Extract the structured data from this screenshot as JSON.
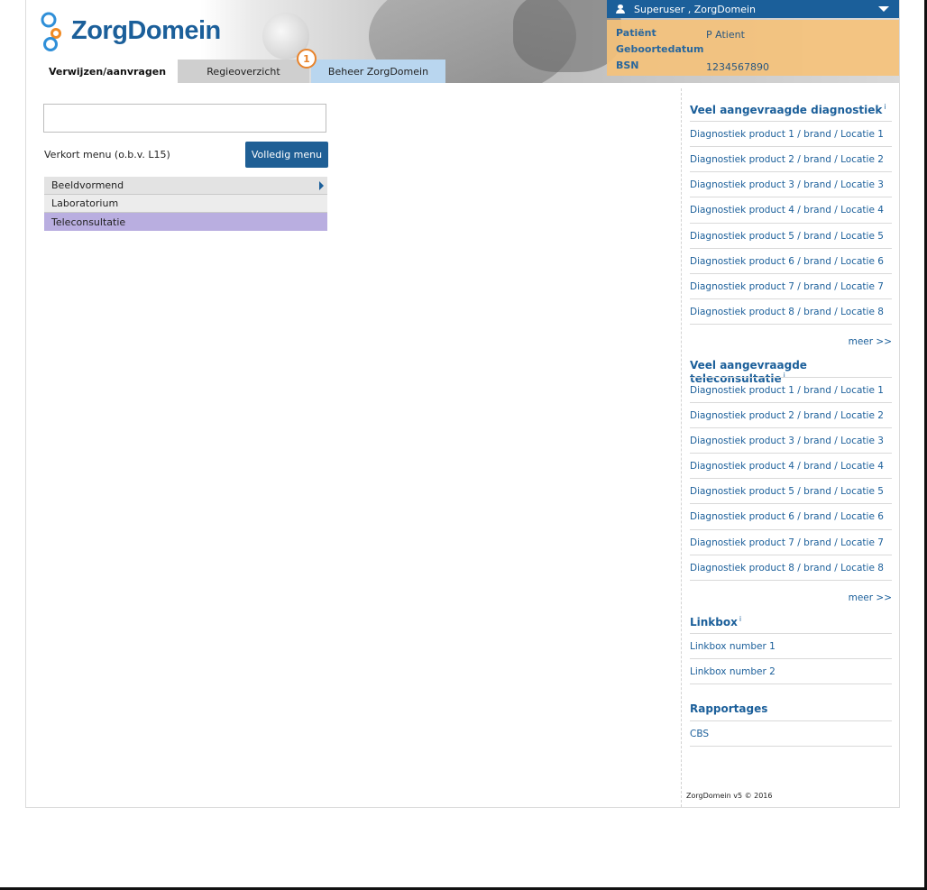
{
  "app": {
    "logo_text": "ZorgDomein"
  },
  "tabs": [
    {
      "label": "Verwijzen/aanvragen"
    },
    {
      "label": "Regieoverzicht"
    },
    {
      "label": "Beheer ZorgDomein"
    }
  ],
  "badge": "1",
  "user": {
    "label": "Superuser , ZorgDomein"
  },
  "patient": {
    "name_label": "Patiënt",
    "name": "P Atient",
    "dob_label": "Geboortedatum",
    "bsn_label": "BSN",
    "bsn": "1234567890"
  },
  "search": {
    "value": ""
  },
  "quick_menu": {
    "label": "Verkort menu (o.b.v. L15)",
    "full_button": "Volledig menu",
    "items": [
      {
        "label": "Beeldvormend"
      },
      {
        "label": "Laboratorium"
      },
      {
        "label": "Teleconsultatie"
      }
    ]
  },
  "diagnostiek": {
    "title": "Veel aangevraagde diagnostiek",
    "info": "i",
    "items": [
      "Diagnostiek product 1 / brand / Locatie 1",
      "Diagnostiek product 2 / brand / Locatie 2",
      "Diagnostiek product 3 / brand / Locatie 3",
      "Diagnostiek product 4 / brand / Locatie 4",
      "Diagnostiek product 5 / brand / Locatie 5",
      "Diagnostiek product 6 / brand / Locatie 6",
      "Diagnostiek product 7 / brand / Locatie 7",
      "Diagnostiek product 8 / brand / Locatie 8"
    ],
    "more": "meer >>"
  },
  "teleconsultatie": {
    "title": "Veel aangevraagde teleconsultatie",
    "info": "i",
    "items": [
      "Diagnostiek product 1 / brand / Locatie 1",
      "Diagnostiek product 2 / brand / Locatie 2",
      "Diagnostiek product 3 / brand / Locatie 3",
      "Diagnostiek product 4 / brand / Locatie 4",
      "Diagnostiek product 5 / brand / Locatie 5",
      "Diagnostiek product 6 / brand / Locatie 6",
      "Diagnostiek product 7 / brand / Locatie 7",
      "Diagnostiek product 8 / brand / Locatie 8"
    ],
    "more": "meer >>"
  },
  "linkbox": {
    "title": "Linkbox",
    "info": "i",
    "items": [
      "Linkbox number 1",
      "Linkbox number 2"
    ]
  },
  "rapportages": {
    "title": "Rapportages",
    "items": [
      "CBS"
    ]
  },
  "footer": "ZorgDomein v5 © 2016",
  "colors": {
    "brand_blue": "#1b5f9a",
    "button_blue": "#1f5f95",
    "badge_orange": "#e8832b",
    "patient_panel": "#f5c27b",
    "highlight_purple": "#b9aee0"
  }
}
